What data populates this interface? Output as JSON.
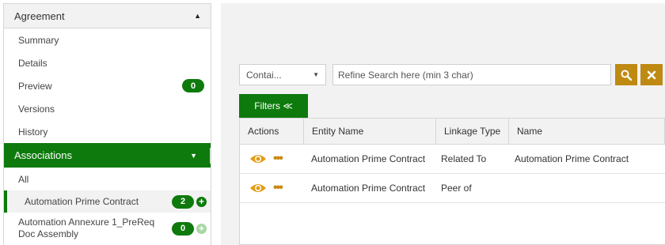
{
  "sidebar": {
    "agreement_header": "Agreement",
    "items": [
      {
        "label": "Summary"
      },
      {
        "label": "Details"
      },
      {
        "label": "Preview",
        "badge": "0"
      },
      {
        "label": "Versions"
      },
      {
        "label": "History"
      }
    ],
    "associations_header": "Associations",
    "assoc_items": [
      {
        "label": "All"
      },
      {
        "label": "Automation Prime Contract",
        "badge": "2"
      },
      {
        "label": "Automation Annexure 1_PreReq Doc Assembly",
        "badge": "0"
      }
    ]
  },
  "search": {
    "select_value": "Contai...",
    "placeholder": "Refine Search here (min 3 char)"
  },
  "filters_label": "Filters ≪",
  "grid": {
    "columns": [
      "Actions",
      "Entity Name",
      "Linkage Type",
      "Name"
    ],
    "rows": [
      {
        "entity": "Automation Prime Contract",
        "linkage": "Related To",
        "name": "Automation Prime Contract"
      },
      {
        "entity": "Automation Prime Contract",
        "linkage": "Peer of",
        "name": ""
      }
    ]
  },
  "icons": {
    "collapse": "triangle-up-icon",
    "expand": "triangle-down-icon",
    "search": "magnifier-icon",
    "clear": "x-icon",
    "view": "eye-icon",
    "more": "ellipsis-icon",
    "add": "plus-circle-icon"
  },
  "colors": {
    "primary_green": "#0e7a0d",
    "accent_gold": "#bf8a12",
    "icon_orange": "#e39d17"
  }
}
